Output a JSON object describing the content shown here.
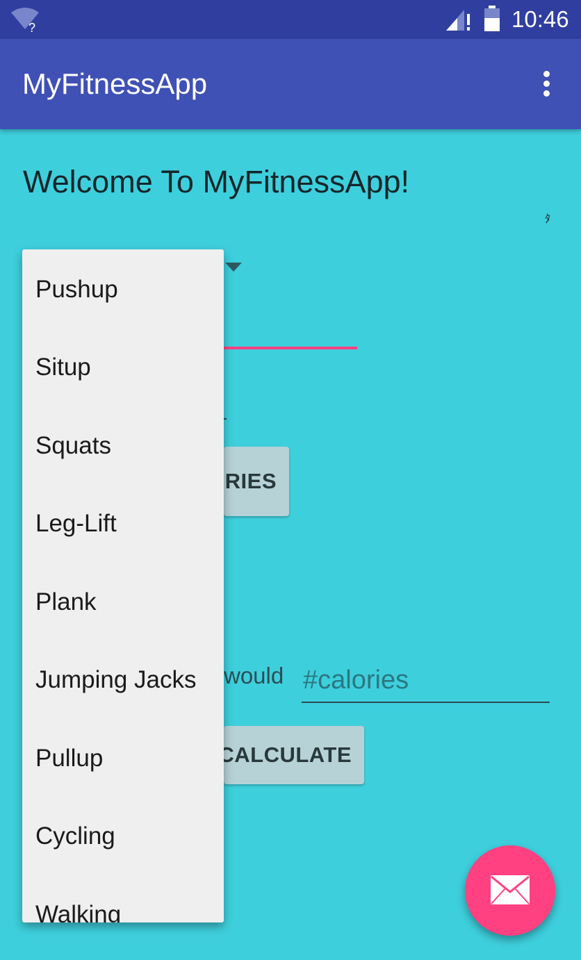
{
  "status_bar": {
    "time": "10:46",
    "icons": [
      "wifi-unknown-icon",
      "signal-icon",
      "battery-icon"
    ]
  },
  "app_bar": {
    "title": "MyFitnessApp",
    "overflow_icon": "more-vert-icon"
  },
  "main": {
    "welcome_text": "Welcome To MyFitnessApp!",
    "corner_mark": "ﾀ",
    "calories_button_label": "ORIES",
    "would_label": "would",
    "calories_input": {
      "value": "",
      "placeholder": "#calories"
    },
    "calculate_button_label": "CALCULATE"
  },
  "exercise_dropdown": {
    "items": [
      {
        "label": "Pushup"
      },
      {
        "label": "Situp"
      },
      {
        "label": "Squats"
      },
      {
        "label": "Leg-Lift"
      },
      {
        "label": "Plank"
      },
      {
        "label": "Jumping Jacks"
      },
      {
        "label": "Pullup"
      },
      {
        "label": "Cycling"
      },
      {
        "label": "Walking"
      }
    ]
  },
  "fab": {
    "icon": "mail-icon"
  },
  "colors": {
    "status_bar": "#303f9f",
    "app_bar": "#3f51b5",
    "background": "#3ecfdd",
    "accent": "#ff4081",
    "button": "#b6d2d6",
    "dropdown_bg": "#efefef"
  }
}
